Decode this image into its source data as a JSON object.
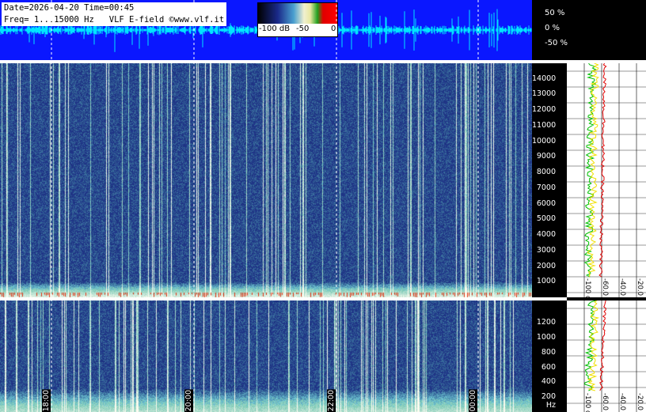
{
  "header": {
    "line1": "Date=2026-04-20 Time=00:45",
    "line2": "Freq= 1...15000 Hz   VLF E-field ©www.vlf.it"
  },
  "colorbar": {
    "labels": [
      "-100 dB",
      "-50",
      "0"
    ]
  },
  "oscillogram": {
    "labels": [
      "50 %",
      "0 %",
      "-50 %"
    ]
  },
  "chart_data": [
    {
      "type": "heatmap",
      "title": "",
      "xlabel": "",
      "ylabel": "",
      "x_ticks": [
        "18:00",
        "20:00",
        "22:00",
        "00:00"
      ],
      "ylim": [
        0,
        15000
      ],
      "y_ticks": [
        "1000",
        "2000",
        "3000",
        "4000",
        "5000",
        "6000",
        "7000",
        "8000",
        "9000",
        "10000",
        "11000",
        "12000",
        "13000",
        "14000"
      ],
      "color_scale_db": [
        -100,
        0
      ]
    },
    {
      "type": "heatmap",
      "ylim": [
        0,
        1500
      ],
      "y_ticks": [
        "200 Hz",
        "400",
        "600",
        "800",
        "1000",
        "1200"
      ]
    },
    {
      "type": "line",
      "xlim_db": [
        -100,
        -20
      ],
      "x_ticks": [
        "-100 dB",
        "-60.0 dB",
        "-40.0 dB",
        "-20.0 dB"
      ],
      "series": [
        {
          "color": "#e00000"
        },
        {
          "color": "#f0e000"
        },
        {
          "color": "#00c000"
        }
      ]
    },
    {
      "type": "line",
      "xlim_db": [
        -100,
        -20
      ],
      "x_ticks": [
        "-100 dB",
        "-60.0 dB",
        "-40.0 dB",
        "-20.0 dB"
      ]
    }
  ],
  "colors": {
    "oscillogram_bg": "#0a17ff",
    "spectrogram_bg": "#1a2a6e",
    "trace": "#00e5ff"
  }
}
